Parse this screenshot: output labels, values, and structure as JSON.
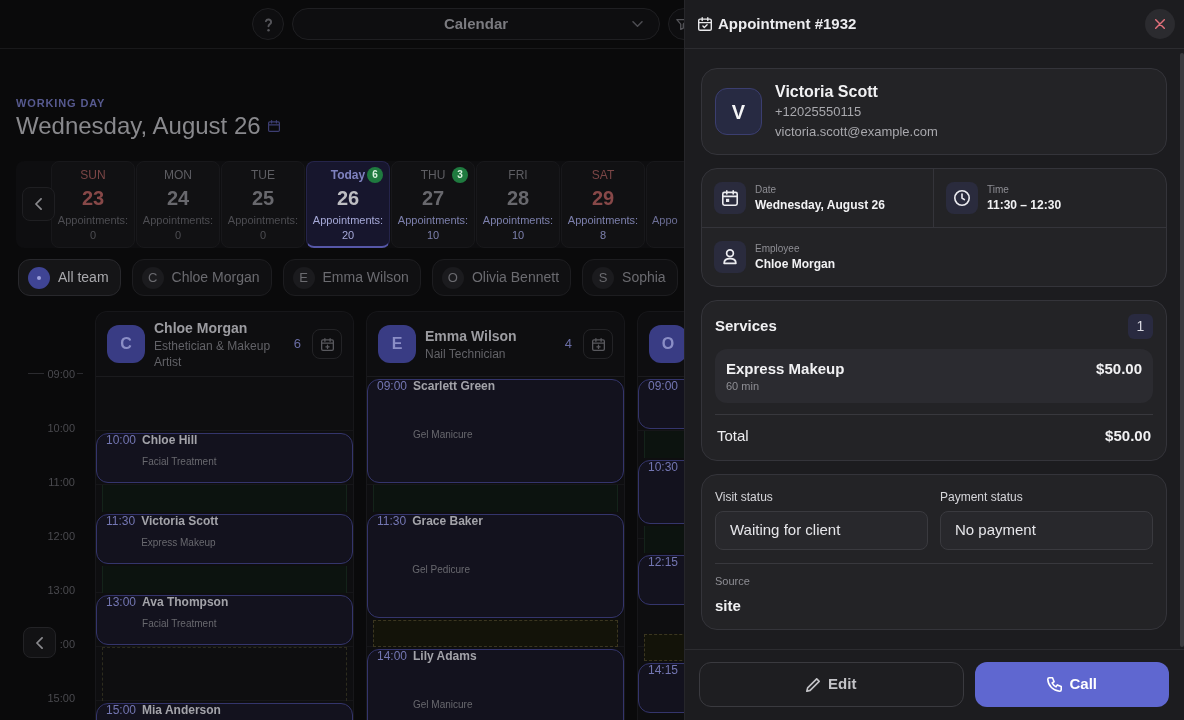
{
  "top_bar": {
    "view_select": {
      "value": "Calendar"
    }
  },
  "day_header": {
    "eyebrow": "WORKING DAY",
    "title": "Wednesday, August 26"
  },
  "days": [
    {
      "kind": "day",
      "weekday": "SUN",
      "day": "23",
      "label": "Appointments:",
      "count": "0",
      "weekend": true,
      "past": true,
      "selected": false
    },
    {
      "kind": "day",
      "weekday": "MON",
      "day": "24",
      "label": "Appointments:",
      "count": "0",
      "weekend": false,
      "past": true,
      "selected": false
    },
    {
      "kind": "day",
      "weekday": "TUE",
      "day": "25",
      "label": "Appointments:",
      "count": "0",
      "weekend": false,
      "past": true,
      "selected": false
    },
    {
      "kind": "day",
      "weekday": "Today",
      "day": "26",
      "label": "Appointments:",
      "count": "20",
      "weekend": false,
      "past": false,
      "selected": true,
      "badge": "6"
    },
    {
      "kind": "day",
      "weekday": "THU",
      "day": "27",
      "label": "Appointments:",
      "count": "10",
      "weekend": false,
      "past": false,
      "selected": false,
      "badge": "3"
    },
    {
      "kind": "day",
      "weekday": "FRI",
      "day": "28",
      "label": "Appointments:",
      "count": "10",
      "weekend": false,
      "past": false,
      "selected": false
    },
    {
      "kind": "day",
      "weekday": "SAT",
      "day": "29",
      "label": "Appointments:",
      "count": "8",
      "weekend": true,
      "past": false,
      "selected": false
    },
    {
      "kind": "partial",
      "label": "Appo"
    }
  ],
  "team_filter": [
    {
      "kind": "all",
      "label": "All team",
      "selected": true
    },
    {
      "kind": "person",
      "initial": "C",
      "label": "Chloe Morgan",
      "selected": false
    },
    {
      "kind": "person",
      "initial": "E",
      "label": "Emma Wilson",
      "selected": false
    },
    {
      "kind": "person",
      "initial": "O",
      "label": "Olivia Bennett",
      "selected": false
    },
    {
      "kind": "person",
      "initial": "S",
      "label": "Sophia",
      "selected": false
    }
  ],
  "time_labels": [
    "09:00",
    "10:00",
    "11:00",
    "12:00",
    "13:00",
    ":00",
    "15:00"
  ],
  "staff_columns": [
    {
      "initial": "C",
      "name": "Chloe Morgan",
      "role": "Esthetician & Makeup Artist",
      "count": "6",
      "appointments": [
        {
          "kind": "short",
          "time": "10:00",
          "client": "Chloe Hill",
          "service": "Facial Treatment",
          "gap": {
            "kind": "free"
          }
        },
        {
          "kind": "short",
          "time": "11:30",
          "client": "Victoria Scott",
          "service": "Express Makeup",
          "gap": {
            "kind": "free"
          }
        },
        {
          "kind": "short",
          "time": "13:00",
          "client": "Ava Thompson",
          "service": "Facial Treatment",
          "gap": {
            "kind": "blocked"
          }
        },
        {
          "kind": "short",
          "time": "15:00",
          "client": "Mia Anderson"
        }
      ]
    },
    {
      "initial": "E",
      "name": "Emma Wilson",
      "role": "Nail Technician",
      "count": "4",
      "appointments": [
        {
          "kind": "long",
          "time": "09:00",
          "client": "Scarlett Green",
          "service": "Gel Manicure",
          "gap": {
            "kind": "free"
          }
        },
        {
          "kind": "long",
          "time": "11:30",
          "client": "Grace Baker",
          "service": "Gel Pedicure",
          "gap": {
            "kind": "break"
          }
        },
        {
          "kind": "long",
          "time": "14:00",
          "client": "Lily Adams",
          "service": "Gel Manicure"
        }
      ]
    },
    {
      "initial": "O",
      "appointments": [
        {
          "kind": "short",
          "time": "09:00",
          "gap": {
            "kind": "free"
          }
        },
        {
          "kind": "medium",
          "time": "10:30",
          "gap": {
            "kind": "free"
          }
        },
        {
          "kind": "short",
          "time": "12:15",
          "gap": {
            "kind": "break"
          }
        },
        {
          "kind": "short",
          "time": "14:15"
        }
      ]
    }
  ],
  "appointment_panel": {
    "title": "Appointment #1932",
    "client": {
      "initial": "V",
      "name": "Victoria Scott",
      "phone": "+12025550115",
      "email": "victoria.scott@example.com"
    },
    "details": [
      {
        "kind": "date",
        "label": "Date",
        "value": "Wednesday, August 26"
      },
      {
        "kind": "time",
        "label": "Time",
        "value": "11:30 – 12:30"
      },
      {
        "kind": "employee",
        "label": "Employee",
        "value": "Chloe Morgan"
      }
    ],
    "services": {
      "title": "Services",
      "count": "1",
      "items": [
        {
          "name": "Express Makeup",
          "duration": "60 min",
          "price": "$50.00"
        }
      ],
      "total_label": "Total",
      "total": "$50.00"
    },
    "visit_status": {
      "label": "Visit status",
      "value": "Waiting for client"
    },
    "payment_status": {
      "label": "Payment status",
      "value": "No payment"
    },
    "source": {
      "label": "Source",
      "value": "site"
    },
    "buttons": [
      {
        "kind": "edit",
        "label": "Edit"
      },
      {
        "kind": "call",
        "label": "Call"
      }
    ]
  }
}
